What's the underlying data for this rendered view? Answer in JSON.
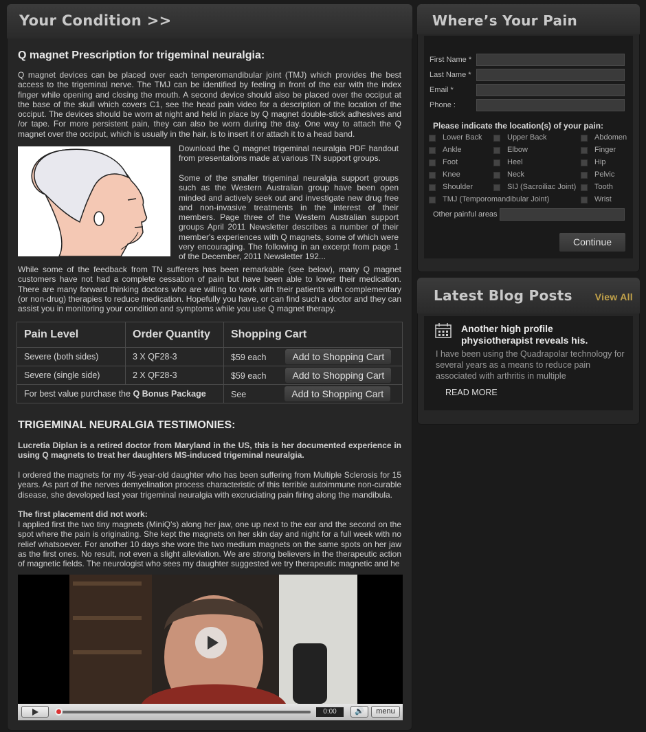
{
  "condition": {
    "header": "Your Condition >>",
    "heading": "Q magnet Prescription for trigeminal neuralgia:",
    "intro": "Q magnet devices can be placed over each temperomandibular joint (TMJ) which provides the best access to the trigeminal nerve. The TMJ can be identified by feeling in front of the ear with the index finger while opening and closing the mouth. A second device should also be placed over the occiput at the base of the skull which covers C1, see the head pain video for a description of the location of the occiput. The devices should be worn at night and held in place by Q magnet double-stick adhesives and /or tape. For more persistent pain, they can also be worn during the day. One way to attach the Q magnet over the occiput, which is usually in the hair, is to insert it or attach it to a head band.",
    "download_text": "Download the Q magnet trigeminal neuralgia PDF handout from presentations made at various TN support groups.",
    "support_text": "Some of the smaller trigeminal neuralgia support groups such as the Western Australian group have been open minded and actively seek out and investigate new drug free and non-invasive treatments in the interest of their members. Page three of the Western Australian support groups April 2011 Newsletter describes a number of their member's experiences with Q magnets, some of which were very encouraging. The following in an excerpt from page 1 of the December, 2011 Newsletter 192...",
    "feedback_text": "While some of the feedback from TN sufferers has been remarkable (see below), many Q magnet customers have not had a complete cessation of pain but have been able to lower their medication. There are many forward thinking doctors who are willing to work with their patients with complementary (or non-drug) therapies to reduce medication. Hopefully you have, or can find such a doctor and they can assist you in monitoring your condition and symptoms while you use Q magnet therapy."
  },
  "table": {
    "headers": [
      "Pain Level",
      "Order Quantity",
      "Shopping Cart"
    ],
    "rows": [
      {
        "level": "Severe (both sides)",
        "qty": "3 X QF28-3",
        "price": "$59 each",
        "button": "Add to Shopping Cart"
      },
      {
        "level": "Severe (single side)",
        "qty": "2 X QF28-3",
        "price": "$59 each",
        "button": "Add to Shopping Cart"
      },
      {
        "level_prefix": "For best value purchase the ",
        "level_bold": "Q Bonus Package",
        "qty": "",
        "price": "See",
        "button": "Add to Shopping Cart"
      }
    ]
  },
  "testimonies": {
    "heading": "TRIGEMINAL NEURALGIA TESTIMONIES:",
    "intro_bold": "Lucretia Diplan is a retired doctor from Maryland in the US, this is her documented experience in using Q magnets to treat her daughters MS-induced trigeminal neuralgia.",
    "para1": "I ordered the magnets for my 45-year-old daughter who has been suffering from Multiple Sclerosis for 15 years. As part of the nerves demyelination process characteristic of this terrible autoimmune non-curable disease, she developed last year trigeminal neuralgia with excruciating pain firing along the mandibula.",
    "sub_bold": "The first placement did not work:",
    "para2": "I applied first the two tiny magnets (MiniQ's) along her jaw, one up next to the ear and the second on the spot where the pain is originating. She kept the magnets on her skin day and night for a full week with no relief whatsoever.  For another 10 days she wore the two medium magnets on the same spots on her jaw as the first ones. No result, not even a slight alleviation. We are strong believers in the therapeutic action of magnetic fields. The neurologist who sees my daughter suggested we try therapeutic magnetic and he"
  },
  "video": {
    "time": "0:00",
    "menu": "menu"
  },
  "pain_form": {
    "title": "Where’s Your Pain",
    "fields": [
      "First Name *",
      "Last Name *",
      "Email *",
      "Phone :"
    ],
    "locations_label": "Please indicate the location(s) of your pain:",
    "locations": [
      [
        "Lower Back",
        "Upper Back",
        "Abdomen"
      ],
      [
        "Ankle",
        "Elbow",
        "Finger"
      ],
      [
        "Foot",
        "Heel",
        "Hip"
      ],
      [
        "Knee",
        "Neck",
        "Pelvic"
      ],
      [
        "Shoulder",
        "SIJ (Sacroiliac Joint)",
        "Tooth"
      ],
      [
        "",
        "TMJ (Temporomandibular Joint)",
        "Wrist"
      ]
    ],
    "other_label": "Other painful areas",
    "continue": "Continue"
  },
  "blog": {
    "title": "Latest Blog Posts",
    "view_all": "View All",
    "post_title": "Another high profile physiotherapist reveals his.",
    "excerpt": "I have been using the Quadrapolar technology for several years as a means to reduce pain associated with arthritis in multiple",
    "read_more": "READ MORE"
  }
}
